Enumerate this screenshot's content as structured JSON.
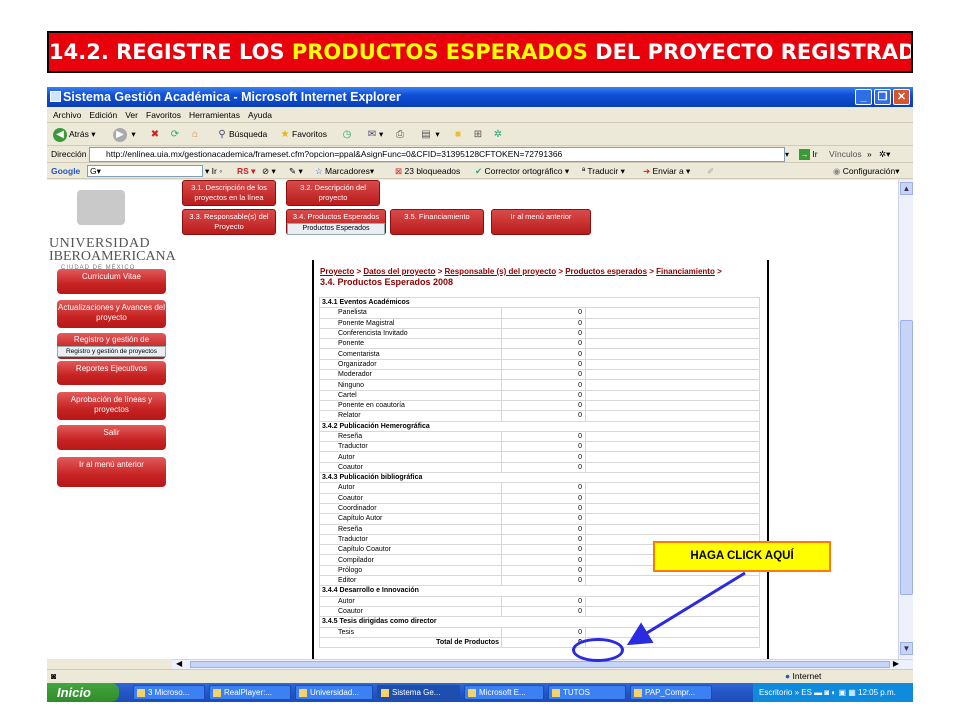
{
  "banner": {
    "prefix": "14.2.  REGISTRE LOS ",
    "highlight": "PRODUCTOS ESPERADOS",
    "suffix": " DEL PROYECTO REGISTRADO"
  },
  "window": {
    "title": "Sistema Gestión Académica - Microsoft Internet Explorer",
    "menu": [
      "Archivo",
      "Edición",
      "Ver",
      "Favoritos",
      "Herramientas",
      "Ayuda"
    ],
    "toolbar": {
      "back": "Atrás",
      "search": "Búsqueda",
      "favorites": "Favoritos"
    },
    "address_label": "Dirección",
    "address": "http://enlinea.uia.mx/gestionacademica/frameset.cfm?opcion=ppal&AsignFunc=0&CFID=31395128CFTOKEN=72791366",
    "go": "Ir",
    "links": "Vínculos",
    "google": {
      "brand": "Google",
      "g_box": "G",
      "ir": "Ir",
      "rs": "RS",
      "bookmarks": "Marcadores",
      "blocked": "23 bloqueados",
      "spell": "Corrector ortográfico",
      "translate": "Traducir",
      "send": "Enviar a",
      "config": "Configuración"
    },
    "status_right": "Internet"
  },
  "top_nav": {
    "b1": "3.1. Descripción de los proyectos en la línea",
    "b2": "3.2. Descripción del proyecto",
    "b3": "3.3. Responsable(s) del Proyecto",
    "b4": "3.4. Productos Esperados",
    "b4_sub": "Productos Esperados",
    "b5": "3.5. Financiamiento",
    "b6": "Ir al menú anterior"
  },
  "logo": {
    "line1": "UNIVERSIDAD",
    "line2": "IBEROAMERICANA",
    "line3": "CIUDAD DE MÉXICO"
  },
  "left_nav": {
    "curriculum": "Curriculum Vitae",
    "actualizaciones": "Actualizaciones y Avances del proyecto",
    "registro": "Registro y gestión de",
    "registro_sub": "Registro y gestión de proyectos",
    "reportes": "Reportes Ejecutivos",
    "aprobacion": "Aprobación de líneas y proyectos",
    "salir": "Salir",
    "menu_anterior": "Ir al menú anterior"
  },
  "breadcrumb": {
    "b1": "Proyecto",
    "b2": "Datos del proyecto",
    "b3": "Responsable (s) del proyecto",
    "b4": "Productos esperados",
    "b5": "Financiamiento",
    "sep": " > "
  },
  "page_title": "3.4. Productos Esperados 2008",
  "table": [
    {
      "type": "sec",
      "label": "3.4.1 Eventos Académicos"
    },
    {
      "type": "row",
      "label": "Panelista",
      "value": "0"
    },
    {
      "type": "row",
      "label": "Ponente Magistral",
      "value": "0"
    },
    {
      "type": "row",
      "label": "Conferencista Invitado",
      "value": "0"
    },
    {
      "type": "row",
      "label": "Ponente",
      "value": "0"
    },
    {
      "type": "row",
      "label": "Comentarista",
      "value": "0"
    },
    {
      "type": "row",
      "label": "Organizador",
      "value": "0"
    },
    {
      "type": "row",
      "label": "Moderador",
      "value": "0"
    },
    {
      "type": "row",
      "label": "Ninguno",
      "value": "0"
    },
    {
      "type": "row",
      "label": "Cartel",
      "value": "0"
    },
    {
      "type": "row",
      "label": "Ponente en coautoría",
      "value": "0"
    },
    {
      "type": "row",
      "label": "Relator",
      "value": "0"
    },
    {
      "type": "sec",
      "label": "3.4.2 Publicación Hemerográfica"
    },
    {
      "type": "row",
      "label": "Reseña",
      "value": "0"
    },
    {
      "type": "row",
      "label": "Traductor",
      "value": "0"
    },
    {
      "type": "row",
      "label": "Autor",
      "value": "0"
    },
    {
      "type": "row",
      "label": "Coautor",
      "value": "0"
    },
    {
      "type": "sec",
      "label": "3.4.3 Publicación bibliográfica"
    },
    {
      "type": "row",
      "label": "Autor",
      "value": "0"
    },
    {
      "type": "row",
      "label": "Coautor",
      "value": "0"
    },
    {
      "type": "row",
      "label": "Coordinador",
      "value": "0"
    },
    {
      "type": "row",
      "label": "Capítulo Autor",
      "value": "0"
    },
    {
      "type": "row",
      "label": "Reseña",
      "value": "0"
    },
    {
      "type": "row",
      "label": "Traductor",
      "value": "0"
    },
    {
      "type": "row",
      "label": "Capítulo Coautor",
      "value": "0"
    },
    {
      "type": "row",
      "label": "Compilador",
      "value": "0"
    },
    {
      "type": "row",
      "label": "Prólogo",
      "value": "0"
    },
    {
      "type": "row",
      "label": "Editor",
      "value": "0"
    },
    {
      "type": "sec",
      "label": "3.4.4 Desarrollo e Innovación"
    },
    {
      "type": "row",
      "label": "Autor",
      "value": "0"
    },
    {
      "type": "row",
      "label": "Coautor",
      "value": "0"
    },
    {
      "type": "sec",
      "label": "3.4.5 Tesis dirigidas como director"
    },
    {
      "type": "row",
      "label": "Tesis",
      "value": "0"
    },
    {
      "type": "total",
      "label": "Total de Productos",
      "value": "0"
    }
  ],
  "callout": "HAGA CLICK AQUÍ",
  "taskbar": {
    "start": "Inicio",
    "tasks": [
      "3 Microso...",
      "RealPlayer:...",
      "Universidad...",
      "Sistema Ge...",
      "Microsoft E...",
      "TUTOS",
      "PAP_Compr..."
    ],
    "desktop": "Escritorio",
    "lang": "ES",
    "time": "12:05 p.m."
  }
}
